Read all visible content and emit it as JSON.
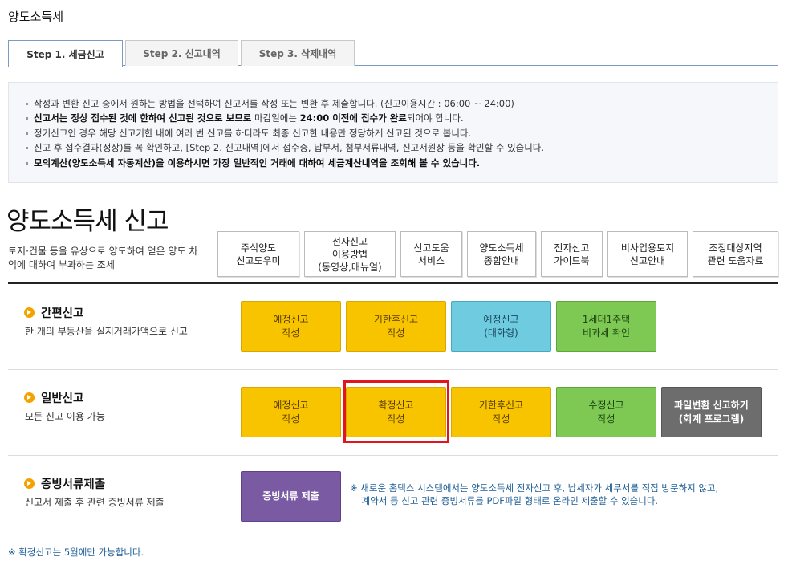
{
  "page_title": "양도소득세",
  "tabs": [
    {
      "label": "Step 1. 세금신고",
      "active": true
    },
    {
      "label": "Step 2. 신고내역",
      "active": false
    },
    {
      "label": "Step 3. 삭제내역",
      "active": false
    }
  ],
  "notice": {
    "items": [
      "작성과 변환 신고 중에서 원하는 방법을 선택하여 신고서를 작성 또는 변환 후 제출합니다. (신고이용시간 : 06:00 ~ 24:00)",
      "정기신고인 경우 해당 신고기한 내에 여러 번 신고를 하더라도 최종 신고한 내용만 정당하게 신고된 것으로 봅니다.",
      "신고 후 접수결과(정상)를 꼭 확인하고, [Step 2. 신고내역]에서 접수증, 납부서, 첨부서류내역, 신고서원장 등을 확인할 수 있습니다.",
      "모의계산(양도소득세 자동계산)을 이용하시면 가장 일반적인 거래에 대하여 세금계산내역을 조회해 볼 수 있습니다."
    ],
    "line2": {
      "part1": "신고서는 정상 접수된 것에 한하여 신고된 것으로 보므로",
      "part2": " 마감일에는 ",
      "part3": "24:00 이전에 접수가 완료",
      "part4": "되어야 합니다."
    }
  },
  "main": {
    "title": "양도소득세 신고",
    "desc": "토지·건물 등을 유상으로 양도하여 얻은 양도 차익에 대하여 부과하는 조세"
  },
  "guide_buttons": [
    "주식양도\n신고도우미",
    "전자신고\n이용방법\n(동영상,매뉴얼)",
    "신고도움\n서비스",
    "양도소득세\n종합안내",
    "전자신고\n가이드북",
    "비사업용토지\n신고안내",
    "조정대상지역\n관련 도움자료"
  ],
  "sections": {
    "simple": {
      "title": "간편신고",
      "sub": "한 개의 부동산을 실지거래가액으로 신고",
      "buttons": [
        "예정신고\n작성",
        "기한후신고\n작성",
        "예정신고\n(대화형)",
        "1세대1주택\n비과세 확인"
      ]
    },
    "general": {
      "title": "일반신고",
      "sub": "모든 신고 이용 가능",
      "buttons": [
        "예정신고\n작성",
        "확정신고\n작성",
        "기한후신고\n작성",
        "수정신고\n작성",
        "파일변환 신고하기\n(회계 프로그램)"
      ]
    },
    "evidence": {
      "title": "증빙서류제출",
      "sub": "신고서 제출 후 관련 증빙서류 제출",
      "button": "증빙서류 제출",
      "note": "※ 새로운 홈택스 시스템에서는 양도소득세 전자신고 후, 납세자가 세무서를 직접 방문하지 않고,\n    계약서 등 신고 관련 증빙서류를 PDF파일 형태로 온라인 제출할 수 있습니다."
    }
  },
  "footnote": "※ 확정신고는 5월에만 가능합니다.",
  "colors": {
    "yellow": "#f8c400",
    "blue": "#6ecbe0",
    "green": "#7ec954",
    "gray": "#6d6d6d",
    "purple": "#7a5aa3",
    "highlight": "#e2141c",
    "note_text": "#1f5e96"
  },
  "icons": {
    "section_bullet": "orange-arrow-circle-icon"
  }
}
